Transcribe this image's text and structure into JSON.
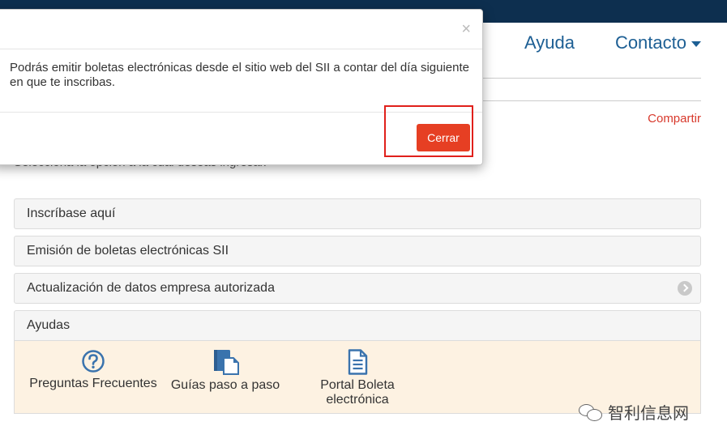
{
  "nav": {
    "help": "Ayuda",
    "contact": "Contacto"
  },
  "share": "Compartir",
  "instruction": "Selecciona la opción a la cual deseas ingresar.",
  "accordion": [
    {
      "label": "Inscríbase aquí"
    },
    {
      "label": "Emisión de boletas electrónicas SII"
    },
    {
      "label": "Actualización de datos empresa autorizada"
    },
    {
      "label": "Ayudas"
    }
  ],
  "help_links": [
    {
      "label": "Preguntas Frecuentes",
      "icon": "question-circle-icon"
    },
    {
      "label": "Guías paso a paso",
      "icon": "book-icon"
    },
    {
      "label": "Portal Boleta electrónica",
      "icon": "document-icon"
    }
  ],
  "modal": {
    "close": "×",
    "body": "Podrás emitir boletas electrónicas desde el sitio web del SII a contar del día siguiente en que te inscribas.",
    "button": "Cerrar"
  },
  "watermark": "智利信息网",
  "colors": {
    "topbar": "#0d2f4f",
    "link": "#1d5f94",
    "accent": "#e63f23",
    "highlight": "#e0201b",
    "help_panel": "#fdf2e2"
  }
}
